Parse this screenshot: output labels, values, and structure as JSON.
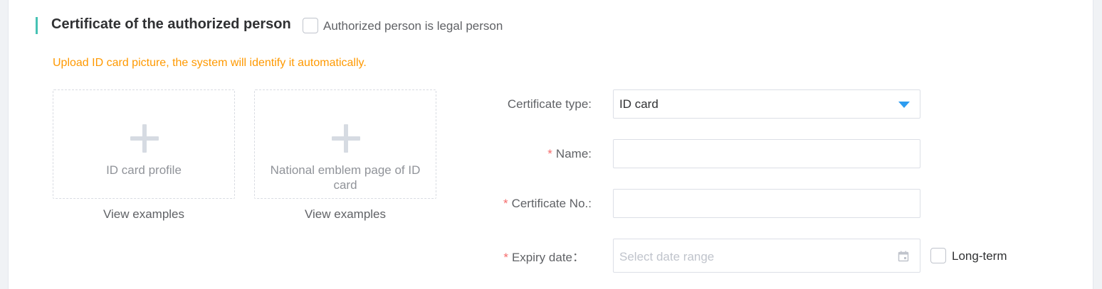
{
  "section": {
    "title": "Certificate of the authorized person",
    "legal_person_checkbox_label": "Authorized person is legal person"
  },
  "upload": {
    "hint": "Upload ID card picture, the system will identify it automatically.",
    "cards": [
      {
        "label": "ID card profile",
        "view_label": "View examples"
      },
      {
        "label": "National emblem page of ID card",
        "view_label": "View examples"
      }
    ]
  },
  "form": {
    "certificate_type": {
      "label": "Certificate type:",
      "value": "ID card"
    },
    "name": {
      "required_mark": "*",
      "label": "Name:",
      "value": ""
    },
    "certificate_no": {
      "required_mark": "*",
      "label": "Certificate No.:",
      "value": ""
    },
    "expiry_date": {
      "required_mark": "*",
      "label": "Expiry date：",
      "placeholder": "Select date range"
    },
    "long_term_label": "Long-term"
  },
  "colors": {
    "accent_bar": "#46c2b4",
    "hint": "#ff9900",
    "required": "#f56c6c",
    "dropdown_caret": "#2d9cf0"
  },
  "icons": [
    "plus-icon",
    "dropdown-caret-icon",
    "calendar-icon"
  ]
}
